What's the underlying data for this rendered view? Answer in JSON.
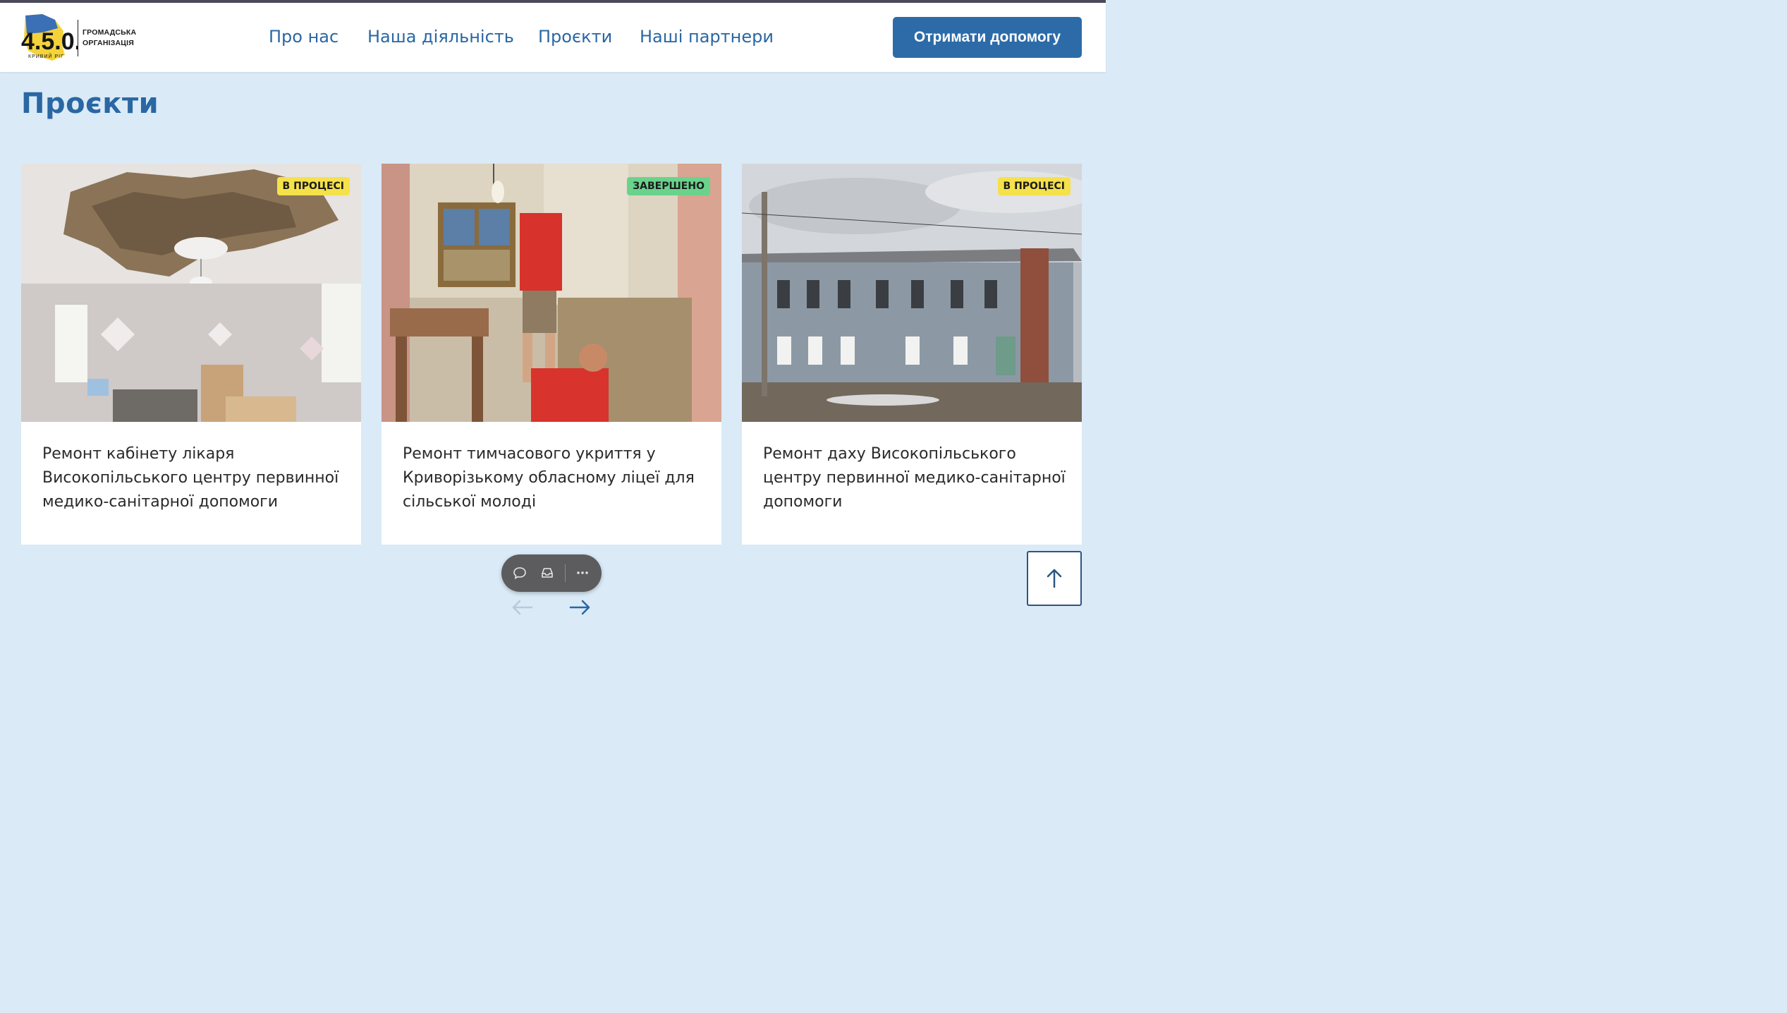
{
  "header": {
    "logo": {
      "mark_text": "4.5.0.",
      "mark_subtext": "КРИВИЙ РІГ",
      "org_line1": "ГРОМАДСЬКА",
      "org_line2": "ОРГАНІЗАЦІЯ"
    },
    "nav": [
      {
        "label": "Про нас"
      },
      {
        "label": "Наша діяльність"
      },
      {
        "label": "Проєкти"
      },
      {
        "label": "Наші партнери"
      }
    ],
    "cta_label": "Отримати допомогу"
  },
  "page": {
    "title": "Проєкти"
  },
  "projects": [
    {
      "status": "В ПРОЦЕСІ",
      "status_color": "#f5e14a",
      "title": "Ремонт кабінету лікаря Високопільського центру первинної медико-санітарної допомоги"
    },
    {
      "status": "ЗАВЕРШЕНО",
      "status_color": "#69d38c",
      "title": "Ремонт тимчасового укриття у Криворізькому обласному ліцеї для сільської молоді"
    },
    {
      "status": "В ПРОЦЕСІ",
      "status_color": "#f5e14a",
      "title": "Ремонт даху Високопільського центру первинної медико-санітарної допомоги"
    }
  ],
  "toolbar": {
    "icons": [
      "comment-icon",
      "inbox-icon",
      "more-icon"
    ]
  },
  "carousel": {
    "prev_icon": "arrow-left-icon",
    "next_icon": "arrow-right-icon"
  },
  "scroll_top_icon": "arrow-up-icon",
  "colors": {
    "primary": "#2a67a3",
    "button": "#2c6ba8",
    "background": "#daeaf7",
    "badge_progress": "#f5e14a",
    "badge_done": "#69d38c"
  }
}
